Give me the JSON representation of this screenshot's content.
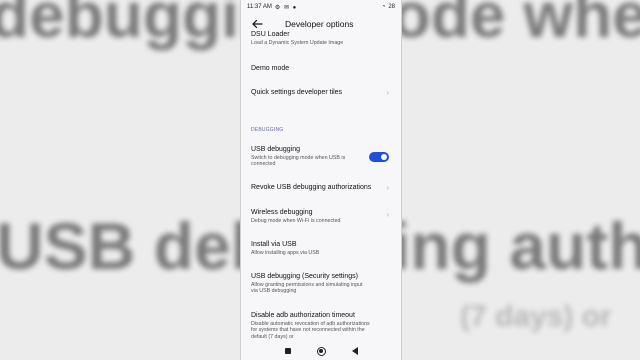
{
  "background": {
    "top_text": "debugging mode when USB is",
    "mid_text": "USB debugging authoriza",
    "bottom_text": "(7 days) or"
  },
  "statusbar": {
    "time": "11:37 AM",
    "battery": "28"
  },
  "appbar": {
    "title": "Developer options"
  },
  "items": [
    {
      "title": "DSU Loader",
      "subtitle": "Load a Dynamic System Update Image"
    },
    {
      "title": "Demo mode",
      "subtitle": ""
    },
    {
      "title": "Quick settings developer tiles",
      "subtitle": ""
    },
    {
      "title": "USB debugging",
      "subtitle": "Switch to debugging mode when USB is connected"
    },
    {
      "title": "Revoke USB debugging authorizations",
      "subtitle": ""
    },
    {
      "title": "Wireless debugging",
      "subtitle": "Debug mode when Wi-Fi is connected"
    },
    {
      "title": "Install via USB",
      "subtitle": "Allow installing apps via USB"
    },
    {
      "title": "USB debugging (Security settings)",
      "subtitle": "Allow granting permissions and simulating input via USB debugging"
    },
    {
      "title": "Disable adb authorization timeout",
      "subtitle": "Disable automatic revocation of adb authorizations for systems that have not reconnected within the default (7 days) or"
    }
  ],
  "section_debugging": "DEBUGGING",
  "usb_debugging_enabled": true,
  "colors": {
    "accent": "#1f4fd8",
    "section_header": "#6a6aa8"
  }
}
